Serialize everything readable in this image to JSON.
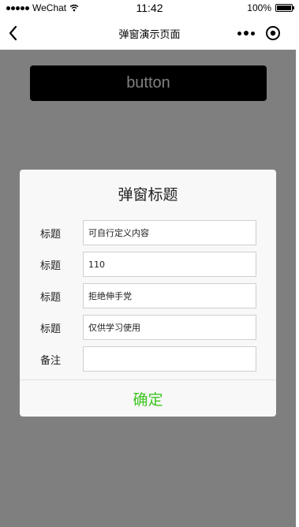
{
  "status_bar": {
    "carrier": "WeChat",
    "time": "11:42",
    "battery_text": "100%",
    "battery_level": 1.0,
    "wifi_icon": "wifi-icon",
    "signal_icon": "signal-dots-icon"
  },
  "nav": {
    "title": "弹窗演示页面",
    "back_icon": "chevron-left-icon",
    "more_icon": "more-dots-icon",
    "close_icon": "target-circle-icon"
  },
  "page": {
    "button_label": "button"
  },
  "modal": {
    "title": "弹窗标题",
    "fields": [
      {
        "label": "标题",
        "value": "可自行定义内容"
      },
      {
        "label": "标题",
        "value": "110"
      },
      {
        "label": "标题",
        "value": "拒绝伸手党"
      },
      {
        "label": "标题",
        "value": "仅供学习使用"
      },
      {
        "label": "备注",
        "value": ""
      }
    ],
    "confirm_label": "确定"
  },
  "colors": {
    "mask": "#808080",
    "modal_bg": "#f8f8f8",
    "confirm_green": "#3cc51f",
    "button_bg": "#000000"
  }
}
